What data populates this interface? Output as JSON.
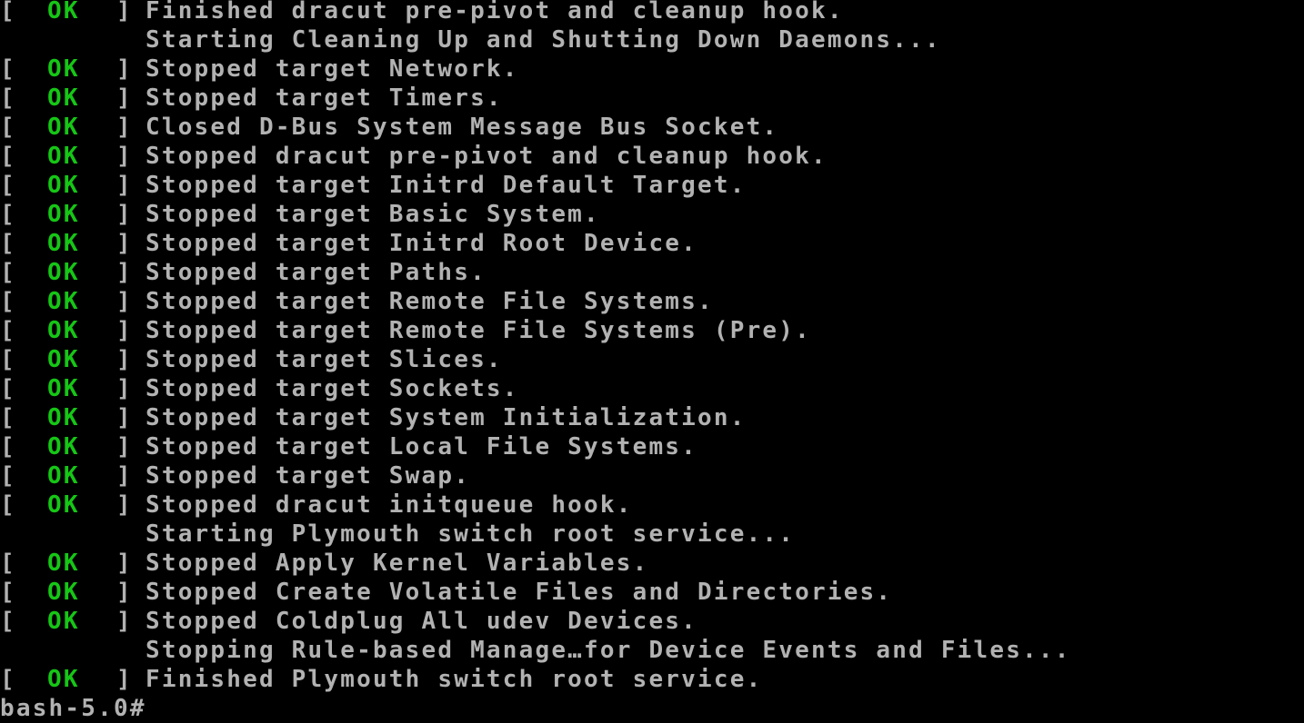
{
  "colors": {
    "background": "#000000",
    "text": "#b2b2b2",
    "ok": "#16c616"
  },
  "lines": [
    {
      "status": "OK",
      "text": "Finished dracut pre-pivot and cleanup hook."
    },
    {
      "status": "",
      "text": "Starting Cleaning Up and Shutting Down Daemons..."
    },
    {
      "status": "OK",
      "text": "Stopped target Network."
    },
    {
      "status": "OK",
      "text": "Stopped target Timers."
    },
    {
      "status": "OK",
      "text": "Closed D-Bus System Message Bus Socket."
    },
    {
      "status": "OK",
      "text": "Stopped dracut pre-pivot and cleanup hook."
    },
    {
      "status": "OK",
      "text": "Stopped target Initrd Default Target."
    },
    {
      "status": "OK",
      "text": "Stopped target Basic System."
    },
    {
      "status": "OK",
      "text": "Stopped target Initrd Root Device."
    },
    {
      "status": "OK",
      "text": "Stopped target Paths."
    },
    {
      "status": "OK",
      "text": "Stopped target Remote File Systems."
    },
    {
      "status": "OK",
      "text": "Stopped target Remote File Systems (Pre)."
    },
    {
      "status": "OK",
      "text": "Stopped target Slices."
    },
    {
      "status": "OK",
      "text": "Stopped target Sockets."
    },
    {
      "status": "OK",
      "text": "Stopped target System Initialization."
    },
    {
      "status": "OK",
      "text": "Stopped target Local File Systems."
    },
    {
      "status": "OK",
      "text": "Stopped target Swap."
    },
    {
      "status": "OK",
      "text": "Stopped dracut initqueue hook."
    },
    {
      "status": "",
      "text": "Starting Plymouth switch root service..."
    },
    {
      "status": "OK",
      "text": "Stopped Apply Kernel Variables."
    },
    {
      "status": "OK",
      "text": "Stopped Create Volatile Files and Directories."
    },
    {
      "status": "OK",
      "text": "Stopped Coldplug All udev Devices."
    },
    {
      "status": "",
      "text": "Stopping Rule-based Manage…for Device Events and Files..."
    },
    {
      "status": "OK",
      "text": "Finished Plymouth switch root service."
    }
  ],
  "prompt": "bash-5.0#"
}
